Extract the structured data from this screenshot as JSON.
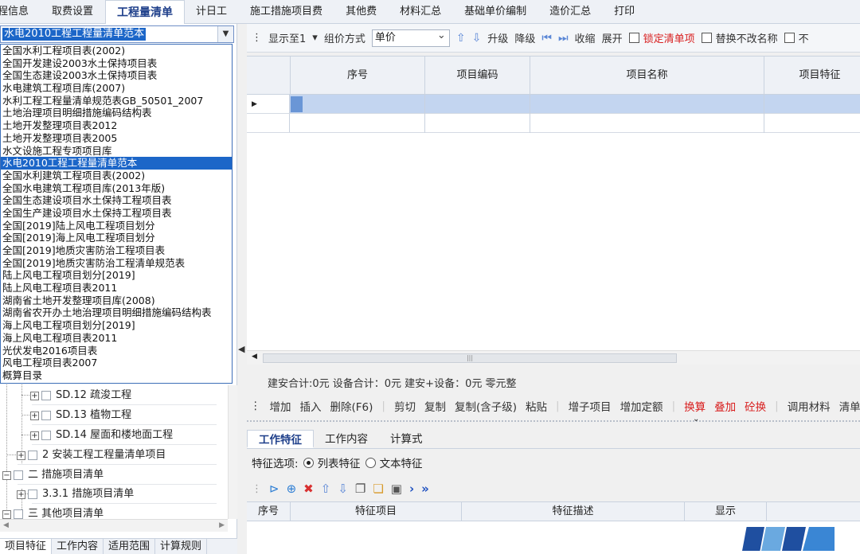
{
  "top_tabs": [
    "程信息",
    "取费设置",
    "工程量清单",
    "计日工",
    "施工措施项目费",
    "其他费",
    "材料汇总",
    "基础单价编制",
    "造价汇总",
    "打印"
  ],
  "combo": {
    "value": "水电2010工程工程量清单范本"
  },
  "dropdown_items": [
    "全国水利工程项目表(2002)",
    "全国开发建设2003水土保持项目表",
    "全国生态建设2003水土保持项目表",
    "水电建筑工程项目库(2007)",
    "水利工程工程量清单规范表GB_50501_2007",
    "土地治理项目明细措施编码结构表",
    "土地开发整理项目表2012",
    "土地开发整理项目表2005",
    "水文设施工程专项项目库",
    "水电2010工程工程量清单范本",
    "全国水利建筑工程项目表(2002)",
    "全国水电建筑工程项目库(2013年版)",
    "全国生态建设项目水土保持工程项目表",
    "全国生产建设项目水土保持工程项目表",
    "全国[2019]陆上风电工程项目划分",
    "全国[2019]海上风电工程项目划分",
    "全国[2019]地质灾害防治工程项目表",
    "全国[2019]地质灾害防治工程清单规范表",
    "陆上风电工程项目划分[2019]",
    "陆上风电工程项目表2011",
    "湖南省土地开发整理项目库(2008)",
    "湖南省农开办土地治理项目明细措施编码结构表",
    "海上风电工程项目划分[2019]",
    "海上风电工程项目表2011",
    "光伏发电2016项目表",
    "风电工程项目表2007",
    "概算目录"
  ],
  "dropdown_selected_index": 9,
  "tree": [
    {
      "label": "SD.12 疏浚工程",
      "level": 3
    },
    {
      "label": "SD.13 植物工程",
      "level": 3
    },
    {
      "label": "SD.14 屋面和楼地面工程",
      "level": 3
    },
    {
      "label": "2 安装工程工程量清单项目",
      "level": 2
    },
    {
      "label": "二 措施项目清单",
      "level": 1
    },
    {
      "label": "3.3.1 措施项目清单",
      "level": 2
    },
    {
      "label": "三 其他项目清单",
      "level": 1
    }
  ],
  "left_bottom_tabs": [
    "项目特征",
    "工作内容",
    "适用范围",
    "计算规则"
  ],
  "toolbar1": {
    "show_to": "显示至1",
    "group_mode_label": "组价方式",
    "group_mode_value": "单价",
    "upgrade": "升级",
    "downgrade": "降级",
    "collapse": "收缩",
    "expand": "展开",
    "lock_list": "锁定清单项",
    "replace_keep_name": "替换不改名称",
    "more": "不"
  },
  "grid_headers": [
    "序号",
    "项目编码",
    "项目名称",
    "项目特征"
  ],
  "summary": "建安合计:0元 设备合计：0元 建安+设备：0元 零元整",
  "toolbar2": {
    "items": [
      "增加",
      "插入",
      "删除(F6)",
      "剪切",
      "复制",
      "复制(含子级)",
      "粘贴",
      "增子项目",
      "增加定额"
    ],
    "red_items": [
      "换算",
      "叠加",
      "砼换"
    ],
    "tail_items": [
      "调用材料",
      "清单"
    ]
  },
  "sub_tabs": [
    "工作特征",
    "工作内容",
    "计算式"
  ],
  "options": {
    "label": "特征选项:",
    "list_feature": "列表特征",
    "text_feature": "文本特征"
  },
  "feature_headers": [
    "序号",
    "特征项目",
    "特征描述",
    "显示"
  ],
  "colors": {
    "accent": "#1c66c8",
    "selected_row": "#c3d5f0",
    "red": "#d81e1e"
  }
}
